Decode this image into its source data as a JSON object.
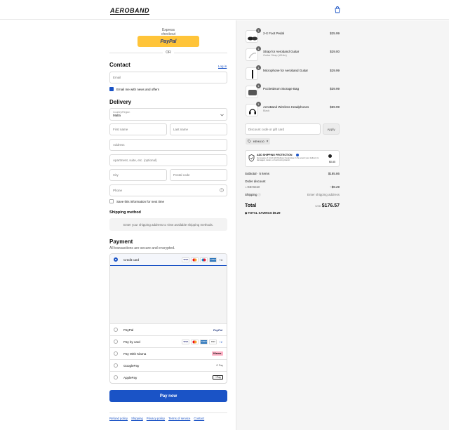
{
  "brand": "AEROBAND",
  "express": {
    "label": "Express checkout",
    "paypal_label": "PayPal",
    "or_label": "OR"
  },
  "contact": {
    "title": "Contact",
    "login": "Log in",
    "email_placeholder": "Email",
    "news_label": "Email me with news and offers"
  },
  "delivery": {
    "title": "Delivery",
    "country_label": "Country/Region",
    "country_value": "Malta",
    "first_name": "First name",
    "last_name": "Last name",
    "address": "Address",
    "apartment": "Apartment, suite, etc. (optional)",
    "city": "City",
    "postal": "Postal code",
    "phone": "Phone",
    "save_label": "Save this information for next time"
  },
  "shipping": {
    "title": "Shipping method",
    "note": "Enter your shipping address to view available shipping methods."
  },
  "payment": {
    "title": "Payment",
    "subtitle": "All transactions are secure and encrypted.",
    "credit_card": "Credit card",
    "more_cards": "+4",
    "paypal": "PayPal",
    "pay_by_card": "Pay by card",
    "pay_by_card_more": "+2",
    "klarna": "Pay With Klarna",
    "klarna_badge": "Klarna.",
    "googlepay": "GooglePay",
    "googlepay_badge": "G Pay",
    "applepay": "ApplePay",
    "applepay_badge": "Pay",
    "pay_now": "Pay now"
  },
  "footer": {
    "refund": "Refund policy",
    "shipping": "Shipping",
    "privacy": "Privacy policy",
    "terms": "Terms of service",
    "contact": "Contact"
  },
  "cart": {
    "items": [
      {
        "qty": "1",
        "name": "2-X Foot Pedal",
        "sub": "",
        "price": "$25.99"
      },
      {
        "qty": "1",
        "name": "Strap for Aeroband Guitar",
        "sub": "Guitar Strap (White)",
        "price": "$29.00"
      },
      {
        "qty": "1",
        "name": "Microphone for Aeroband Guitar",
        "sub": "",
        "price": "$29.99"
      },
      {
        "qty": "1",
        "name": "PocketDrum Storage Bag",
        "sub": "",
        "price": "$39.99"
      },
      {
        "qty": "1",
        "name": "AeroBand Wireless Headphones",
        "sub": "Black",
        "price": "$59.99"
      }
    ],
    "discount_placeholder": "Discount code or gift card",
    "apply": "Apply",
    "code": "KEHU10",
    "protection_title": "ADD SHIPPING PROTECTION",
    "protection_text": "Get peace of mind with Delivery Guarantee in the event your delivery is damaged, stolen, or lost during transit.",
    "protection_price": "$0.85",
    "subtotal_label": "Subtotal · 5 items",
    "subtotal_value": "$185.86",
    "order_discount": "Order discount",
    "discount_code": "KEHU10",
    "discount_value": "−$9.29",
    "shipping_label": "Shipping",
    "shipping_value": "Enter shipping address",
    "total_label": "Total",
    "currency": "USD",
    "total_value": "$176.57",
    "savings_label": "TOTAL SAVINGS",
    "savings_value": "$9.29"
  }
}
